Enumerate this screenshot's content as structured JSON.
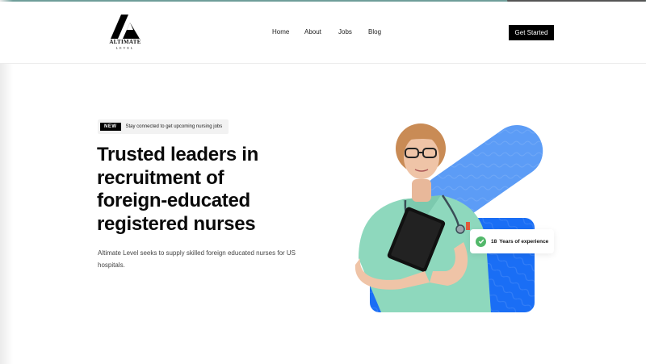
{
  "brand": {
    "name": "ALTIMATE",
    "sub": "LEVEL"
  },
  "nav": {
    "home": "Home",
    "about": "About",
    "jobs": "Jobs",
    "blog": "Blog"
  },
  "cta": {
    "label": "Get Started"
  },
  "hero": {
    "badge_tag": "NEW",
    "badge_text": "Stay connected to get upcoming nursing jobs",
    "headline_lines": [
      "Trusted leaders in",
      "recruitment of",
      "foreign-educated",
      "registered nurses"
    ],
    "description": "Altimate Level seeks to supply skilled foreign educated nurses for US hospitals."
  },
  "experience": {
    "number": "18",
    "label": "Years of experience"
  },
  "colors": {
    "accent_blue": "#1a6ef5",
    "light_blue": "#5c9cf6",
    "check_green": "#52b86a",
    "scrubs": "#8ed8bd"
  },
  "icons": {
    "logo": "mountain-logo-icon",
    "check": "check-icon"
  }
}
